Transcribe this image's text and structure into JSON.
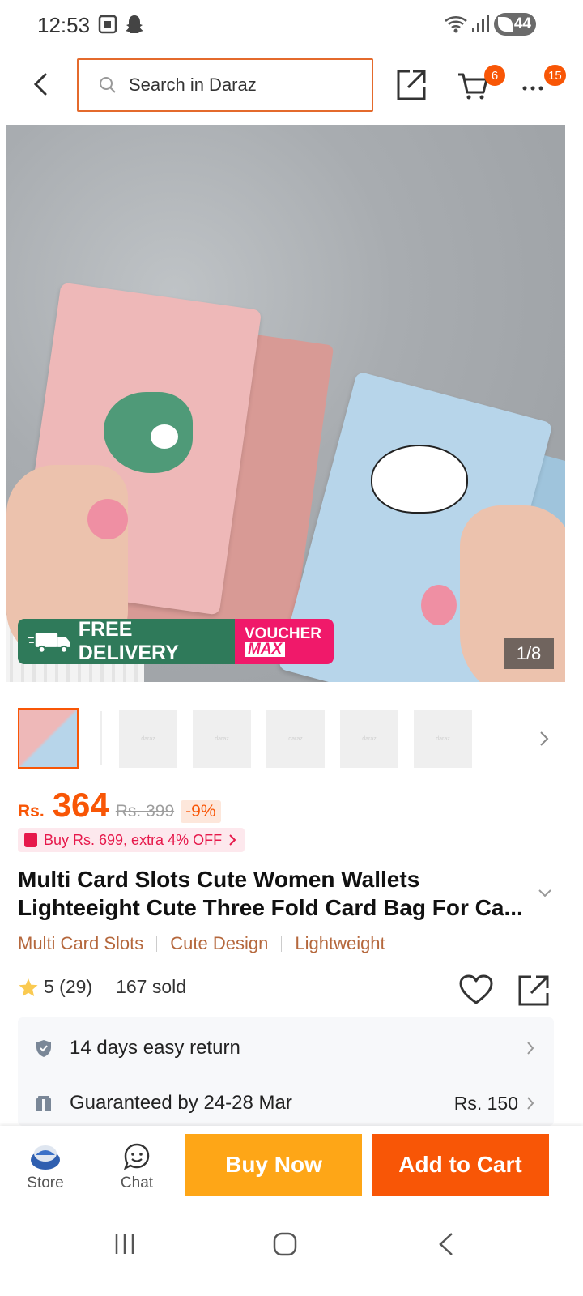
{
  "status_bar": {
    "time": "12:53",
    "battery": "44"
  },
  "nav": {
    "search_placeholder": "Search in Daraz",
    "cart_badge": "6",
    "more_badge": "15"
  },
  "gallery": {
    "promo_free": "FREE DELIVERY",
    "promo_voucher_top": "VOUCHER",
    "promo_voucher_bottom": "MAX",
    "counter": "1/8",
    "thumb_placeholder": "daraz"
  },
  "price": {
    "currency": "Rs.",
    "amount": "364",
    "original": "Rs. 399",
    "discount": "-9%"
  },
  "offer": {
    "text": "Buy Rs. 699, extra 4% OFF"
  },
  "product": {
    "title_line1": "Multi Card Slots Cute Women Wallets",
    "title_line2": "Lighteeight Cute Three Fold Card Bag For Ca...",
    "tags": [
      "Multi Card Slots",
      "Cute Design",
      "Lightweight"
    ],
    "rating": "5 (29)",
    "sold": "167 sold"
  },
  "info": {
    "return_text": "14 days easy return",
    "delivery_text": "Guaranteed by 24-28 Mar",
    "delivery_fee": "Rs. 150"
  },
  "action_bar": {
    "store": "Store",
    "chat": "Chat",
    "buy_now": "Buy Now",
    "add_to_cart": "Add to Cart"
  },
  "colors": {
    "accent": "#f85606",
    "buy_now": "#fea617",
    "tag_text": "#b5683d"
  }
}
